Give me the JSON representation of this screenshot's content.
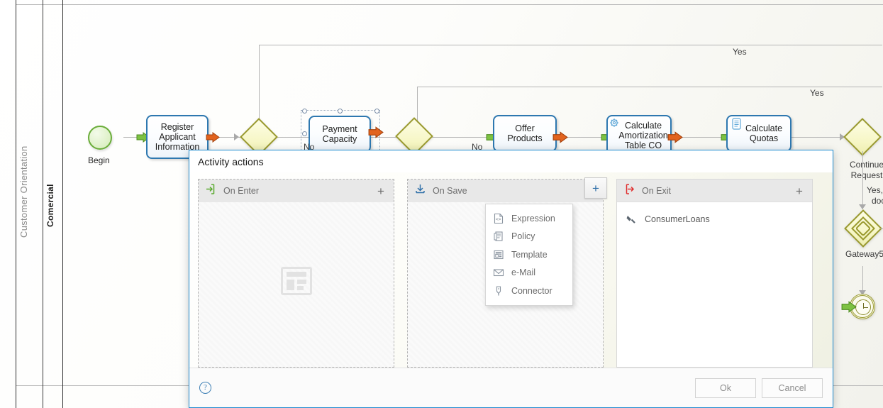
{
  "diagram": {
    "lanes": [
      {
        "label": "Customer Orientation"
      },
      {
        "label": "Comercial"
      }
    ],
    "start_event": {
      "label": "Begin"
    },
    "tasks": [
      {
        "label": "Register Applicant Information"
      },
      {
        "label": "Payment Capacity"
      },
      {
        "label": "Offer Products"
      },
      {
        "label": "Calculate Amortization Table CO"
      },
      {
        "label": "Calculate Quotas"
      }
    ],
    "gateways": [
      {
        "label": ""
      },
      {
        "label": ""
      },
      {
        "label": "Continue Request"
      },
      {
        "label": "Gateway5"
      }
    ],
    "edge_labels": [
      {
        "text": "Yes"
      },
      {
        "text": "Yes"
      },
      {
        "text": "No"
      },
      {
        "text": "No"
      },
      {
        "text": "Yes,"
      },
      {
        "text": "doc"
      }
    ]
  },
  "dialog": {
    "title": "Activity actions",
    "columns": [
      {
        "name": "on-enter",
        "title": "On Enter",
        "icon": "enter-arrow-icon",
        "plus_label": "+",
        "items": []
      },
      {
        "name": "on-save",
        "title": "On Save",
        "icon": "save-download-icon",
        "plus_label": "+",
        "items": []
      },
      {
        "name": "on-exit",
        "title": "On Exit",
        "icon": "exit-arrow-icon",
        "plus_label": "+",
        "items": [
          {
            "label": "ConsumerLoans",
            "icon": "connector-icon"
          }
        ]
      }
    ],
    "context_menu": {
      "items": [
        {
          "label": "Expression",
          "icon": "expression-icon"
        },
        {
          "label": "Policy",
          "icon": "policy-icon"
        },
        {
          "label": "Template",
          "icon": "template-icon"
        },
        {
          "label": "e-Mail",
          "icon": "mail-icon"
        },
        {
          "label": "Connector",
          "icon": "connector-plug-icon"
        }
      ]
    },
    "footer": {
      "help_label": "?",
      "ok_label": "Ok",
      "cancel_label": "Cancel"
    }
  },
  "colors": {
    "accent_blue": "#1e8bd0",
    "task_border": "#2e78b0",
    "gateway": "#9a9a2e",
    "start_green": "#6aad3a",
    "exit_red": "#e03131",
    "enter_green": "#5aaa2e"
  }
}
